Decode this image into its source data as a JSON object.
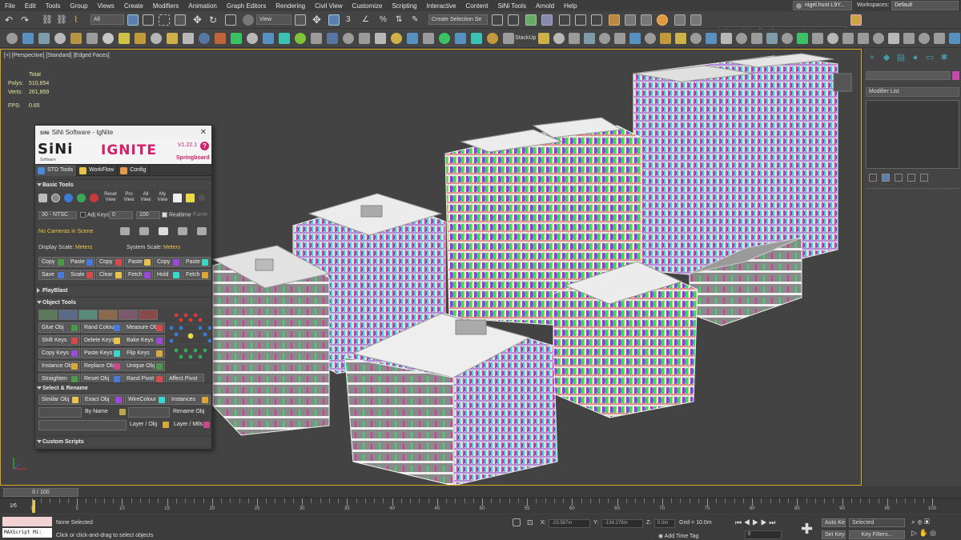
{
  "menu": [
    "File",
    "Edit",
    "Tools",
    "Group",
    "Views",
    "Create",
    "Modifiers",
    "Animation",
    "Graph Editors",
    "Rendering",
    "Civil View",
    "Customize",
    "Scripting",
    "Interactive",
    "Content",
    "SiNi Tools",
    "Arnold",
    "Help"
  ],
  "user": "nigel.hunt L9Y...",
  "workspaces_label": "Workspaces:",
  "workspace": "Default",
  "toolbar": {
    "filter": "All",
    "view": "View",
    "selection_set": "Create Selection Se",
    "path": "C:\\Users\\bluegf\\local\\Documents\\3ds Max 2021",
    "stackup": "StackUp"
  },
  "viewport": {
    "label": "[+] [Perspective] [Standard] [Edged Faces]",
    "stats": {
      "total_label": "Total",
      "polys_label": "Polys:",
      "polys": "510,854",
      "verts_label": "Verts:",
      "verts": "261,859",
      "fps_label": "FPS:",
      "fps": "0.65"
    }
  },
  "right_panel": {
    "modifier_list": "Modifier List"
  },
  "ignite": {
    "title": "SiNi Software - IgNite",
    "title_mark": "SiNi",
    "logo": "SiNi",
    "logo_sub": "Software",
    "product": "IGNITE",
    "version": "V1.22.1",
    "help": "?",
    "springboard": "Springboard",
    "tabs": [
      "STD Tools",
      "WorkFlow",
      "Config"
    ],
    "sections": {
      "basic": "Basic Tools",
      "playblast": "PlayBlast",
      "object": "Object Tools",
      "select": "Select & Rename",
      "custom": "Custom Scripts"
    },
    "basic_buttons": [
      "Reset View",
      "Pro View",
      "All View",
      "My View"
    ],
    "fps_select": "30 - NTSC",
    "adj_keys": "Adj Keys",
    "spin1": "0",
    "spin2": "100",
    "realtime": "Realtime",
    "fume": "Fume",
    "no_cameras": "No Cameras in Scene",
    "display_scale_label": "Display Scale:",
    "display_scale": "Meters",
    "system_scale_label": "System Scale:",
    "system_scale": "Meters",
    "copy_row1": [
      "Copy",
      "Paste",
      "Copy",
      "Paste",
      "Copy",
      "Paste"
    ],
    "copy_row2": [
      "Save",
      "Scale",
      "Clear",
      "Fetch",
      "Hold",
      "Fetch"
    ],
    "obj_rows": [
      [
        "Glue Obj",
        "Rand Colour",
        "Measure Obj"
      ],
      [
        "Shift Keys",
        "Delete Keys",
        "Bake Keys"
      ],
      [
        "Copy Keys",
        "Paste Keys",
        "Flip Keys"
      ],
      [
        "Instance Obj",
        "Replace Obj",
        "Unique Obj"
      ],
      [
        "Straighten",
        "Reset Obj",
        "Rand Pivot",
        "Affect Pivot"
      ]
    ],
    "select_row1": [
      "Similar Obj",
      "Exact Obj",
      "WireColour",
      "Instances"
    ],
    "select_row2": [
      "By Name",
      "Rename Obj"
    ],
    "select_row3": [
      "Layer / Obj",
      "Layer / Mtls"
    ]
  },
  "timeline": {
    "slider": "0 / 100",
    "ticks": [
      "0",
      "5",
      "10",
      "15",
      "20",
      "25",
      "30",
      "35",
      "40",
      "45",
      "50",
      "55",
      "60",
      "65",
      "70",
      "75",
      "80",
      "85",
      "90",
      "95",
      "100"
    ]
  },
  "status": {
    "maxscript": "MAXScript Mi:",
    "none_selected": "None Selected",
    "hint": "Click or click-and-drag to select objects",
    "x_label": "X:",
    "x": "-23.567m",
    "y_label": "Y:",
    "y": "-134.276m",
    "z_label": "Z:",
    "z": "0.0m",
    "grid": "Grid = 10.0m",
    "add_time_tag": "Add Time Tag",
    "frame": "0",
    "auto_key": "Auto Key",
    "set_key": "Set Key",
    "selected": "Selected",
    "key_filters": "Key Filters..."
  },
  "colors": {
    "accent": "#d2206c",
    "viewport_border": "#d9a21c",
    "stats": "#e8e8a0"
  }
}
